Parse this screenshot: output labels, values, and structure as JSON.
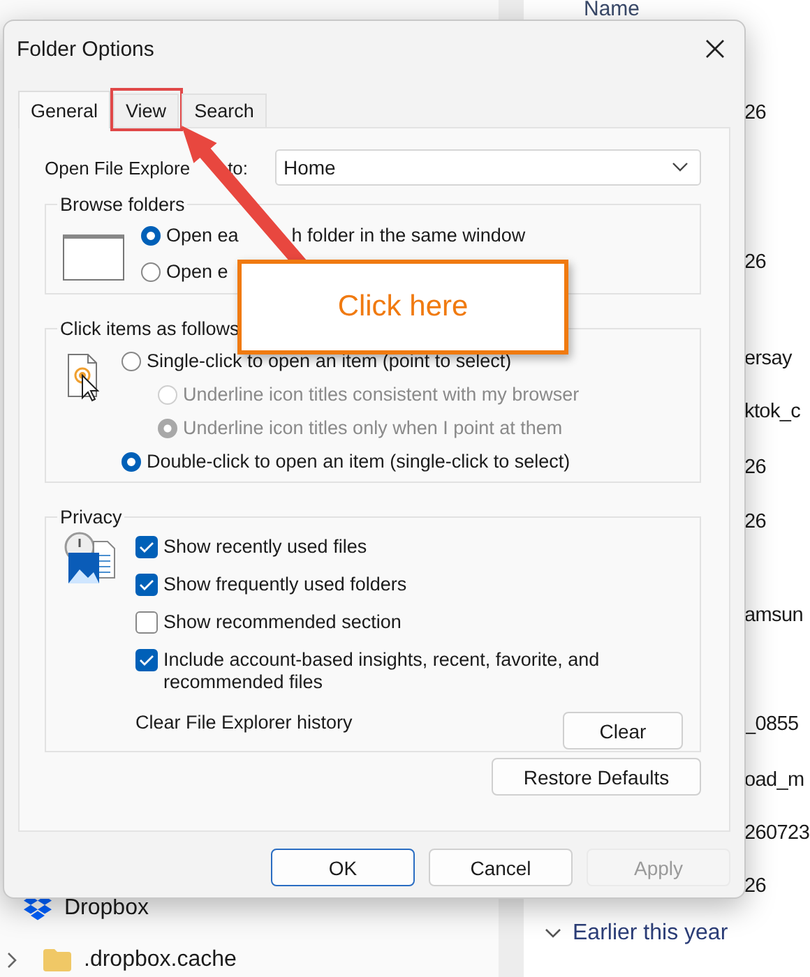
{
  "explorer": {
    "column_header": "Name",
    "right_items": [
      "26",
      "26",
      "ersay",
      "ktok_c",
      "26",
      "26",
      "amsun",
      "_0855",
      "oad_m",
      "260723",
      "26"
    ],
    "section": "Earlier this year",
    "nav_items": [
      {
        "label": "Dropbox",
        "kind": "dropbox"
      },
      {
        "label": ".dropbox.cache",
        "kind": "folder"
      }
    ]
  },
  "window": {
    "title": "Folder Options"
  },
  "tabs": [
    {
      "label": "General",
      "selected": true,
      "highlighted": false
    },
    {
      "label": "View",
      "selected": false,
      "highlighted": true
    },
    {
      "label": "Search",
      "selected": false,
      "highlighted": false
    }
  ],
  "open_to": {
    "label_parts": [
      "Open File Explore",
      "to:"
    ],
    "value": "Home"
  },
  "browse_folders": {
    "title": "Browse folders",
    "options": [
      {
        "label_parts": [
          "Open ea",
          "h folder in the same window"
        ],
        "selected": true
      },
      {
        "label_parts": [
          "Open e"
        ],
        "selected": false
      }
    ]
  },
  "click_items": {
    "title": "Click items as follows",
    "options": [
      {
        "label": "Single-click to open an item (point to select)",
        "selected": false,
        "disabled": false,
        "children": [
          {
            "label": "Underline icon titles consistent with my browser",
            "selected": false,
            "disabled": true
          },
          {
            "label": "Underline icon titles only when I point at them",
            "selected": true,
            "disabled": true
          }
        ]
      },
      {
        "label": "Double-click to open an item (single-click to select)",
        "selected": true,
        "disabled": false
      }
    ]
  },
  "privacy": {
    "title": "Privacy",
    "checkboxes": [
      {
        "label": "Show recently used files",
        "checked": true
      },
      {
        "label": "Show frequently used folders",
        "checked": true
      },
      {
        "label": "Show recommended section",
        "checked": false
      },
      {
        "label": "Include account-based insights, recent, favorite, and recommended files",
        "checked": true
      }
    ],
    "clear_label": "Clear File Explorer history",
    "clear_button": "Clear"
  },
  "restore_button": "Restore Defaults",
  "buttons": [
    {
      "label": "OK",
      "default": true,
      "disabled": false
    },
    {
      "label": "Cancel",
      "default": false,
      "disabled": false
    },
    {
      "label": "Apply",
      "default": false,
      "disabled": true
    }
  ],
  "annotation": {
    "callout": "Click here"
  }
}
